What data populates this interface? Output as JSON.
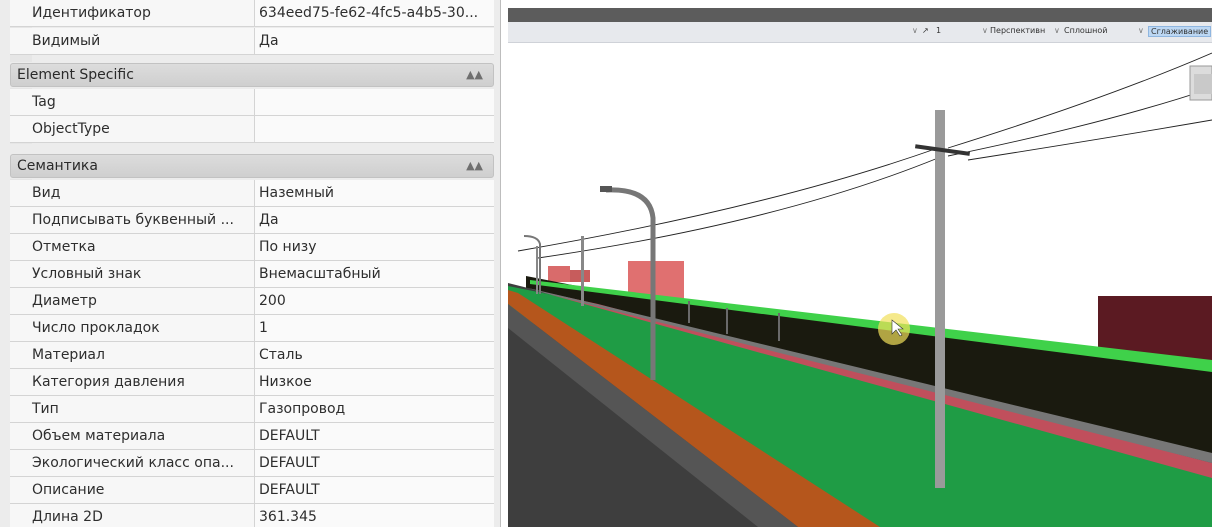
{
  "properties": {
    "top_rows": [
      {
        "name": "Идентификатор",
        "value": "634eed75-fe62-4fc5-a4b5-30..."
      },
      {
        "name": "Видимый",
        "value": "Да"
      }
    ],
    "element_specific": {
      "title": "Element Specific",
      "rows": [
        {
          "name": "Tag",
          "value": ""
        },
        {
          "name": "ObjectType",
          "value": ""
        }
      ]
    },
    "semantics": {
      "title": "Семантика",
      "rows": [
        {
          "name": "Вид",
          "value": "Наземный"
        },
        {
          "name": "Подписывать буквенный ...",
          "value": "Да"
        },
        {
          "name": "Отметка",
          "value": "По низу"
        },
        {
          "name": "Условный знак",
          "value": "Внемасштабный"
        },
        {
          "name": "Диаметр",
          "value": "200"
        },
        {
          "name": "Число прокладок",
          "value": "1"
        },
        {
          "name": "Материал",
          "value": "Сталь"
        },
        {
          "name": "Категория давления",
          "value": "Низкое"
        },
        {
          "name": "Тип",
          "value": "Газопровод"
        },
        {
          "name": "Объем материала",
          "value": "DEFAULT"
        },
        {
          "name": "Экологический класс опа...",
          "value": "DEFAULT"
        },
        {
          "name": "Описание",
          "value": "DEFAULT"
        },
        {
          "name": "Длина 2D",
          "value": "361.345"
        }
      ]
    }
  },
  "viewport": {
    "toolbar": {
      "zoom_value": "1",
      "projection": "Перспективн",
      "render_mode": "Сплошной",
      "smoothing": "Сглаживание"
    },
    "colors": {
      "pipe_highlight": "#3fd14a",
      "road_surface": "#3c3c3c",
      "green_lane": "#1f9c45",
      "brown_lane": "#b5561c",
      "red_lane": "#c04f5c"
    }
  }
}
